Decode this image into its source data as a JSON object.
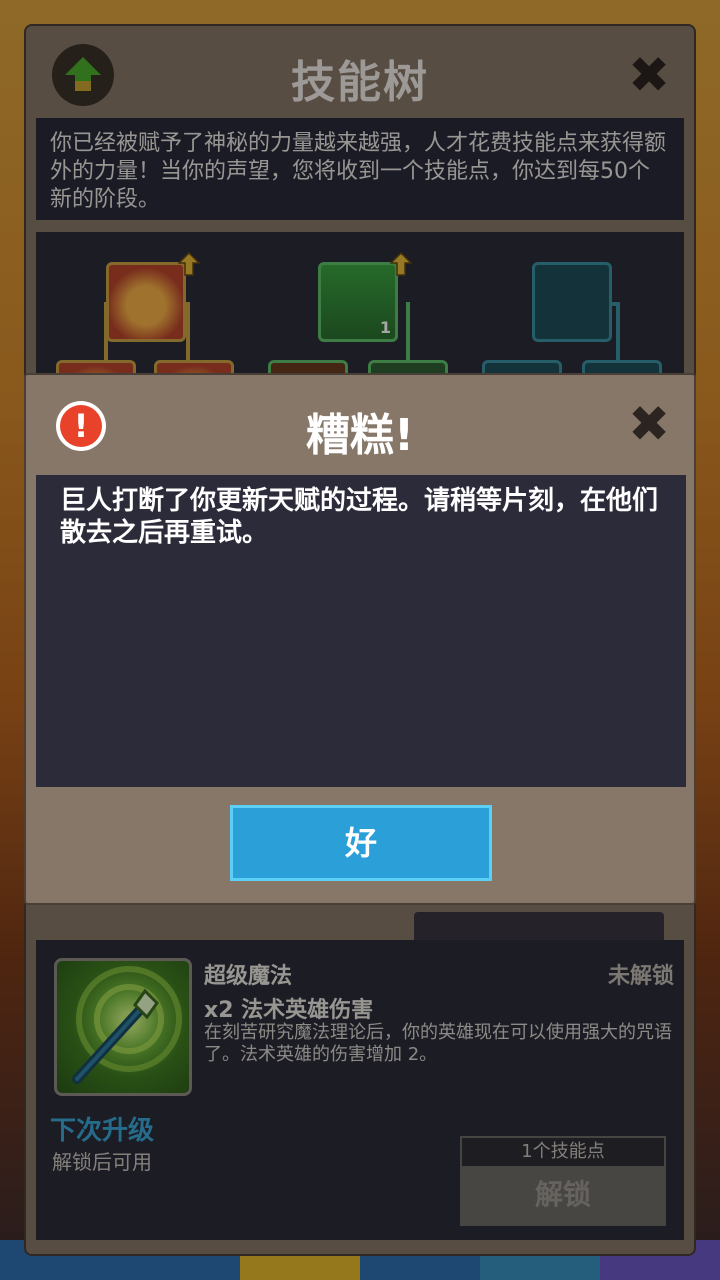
{
  "skill_tree": {
    "title": "技能树",
    "description": "你已经被赋予了神秘的力量越来越强，人才花费技能点来获得额外的力量！当你的声望，您将收到一个技能点，你达到每50个新的阶段。",
    "node_count_label": "1"
  },
  "skill": {
    "name": "超级魔法",
    "status": "未解锁",
    "effect": "x2 法术英雄伤害",
    "description": "在刻苦研究魔法理论后，你的英雄现在可以使用强大的咒语了。法术英雄的伤害增加 2。",
    "next_label": "下次升级",
    "next_sub": "解锁后可用",
    "cost_label": "1个技能点",
    "unlock_label": "解锁"
  },
  "dialog": {
    "title": "糟糕!",
    "message": "巨人打断了你更新天赋的过程。请稍等片刻，在他们散去之后再重试。",
    "ok_label": "好",
    "icon": "exclamation-icon"
  },
  "colors": {
    "panel": "#877768",
    "body_dark": "#2c2b3a",
    "ok_button": "#2ba0d8",
    "error_icon": "#e8432a",
    "link_blue": "#3aa7d6"
  }
}
